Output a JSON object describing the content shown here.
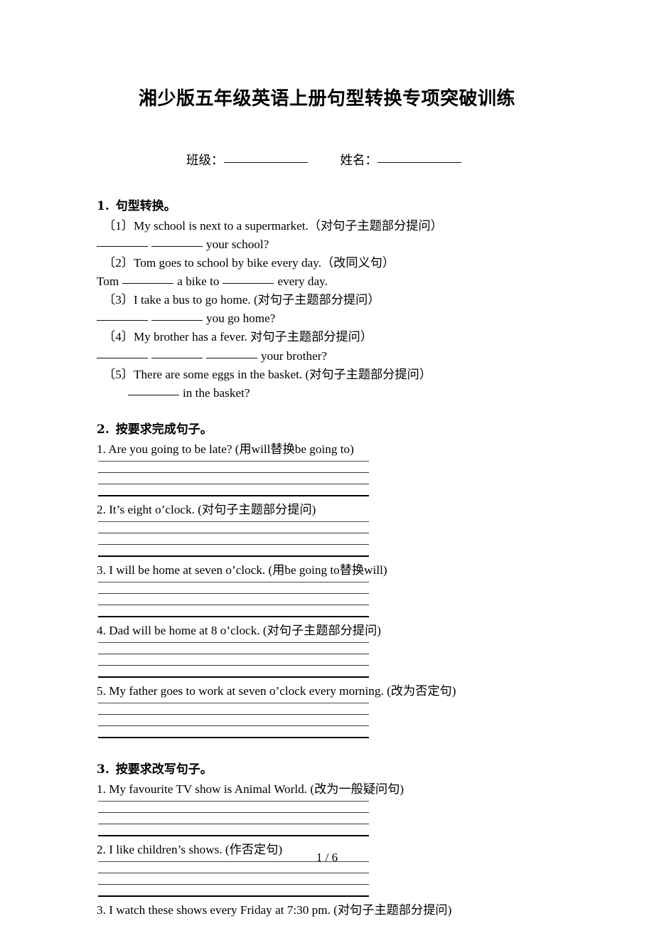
{
  "document": {
    "title": "湘少版五年级英语上册句型转换专项突破训练",
    "footer_page": "1 / 6"
  },
  "id_row": {
    "class_label": "班级：",
    "name_label": "姓名："
  },
  "sections": [
    {
      "number": "1.",
      "heading": "句型转换。",
      "items": [
        {
          "prompt": "〔1〕My school is next to a supermarket.（对句子主题部分提问）",
          "answer": "your school?"
        },
        {
          "prompt": "〔2〕Tom goes to school by bike every day.（改同义句）",
          "answer": "Tom a bike to every day."
        },
        {
          "prompt": "〔3〕I take a bus to go home. (对句子主题部分提问）",
          "answer": "you go home?"
        },
        {
          "prompt": "〔4〕My brother has a fever. 对句子主题部分提问）",
          "answer": "your brother?"
        },
        {
          "prompt": "〔5〕There are some eggs in the basket. (对句子主题部分提问）",
          "answer": "in the basket?"
        }
      ]
    },
    {
      "number": "2.",
      "heading": "按要求完成句子。",
      "items": [
        {
          "prompt": "1. Are you going to be late? (用will替换be going to)"
        },
        {
          "prompt": "2. It's eight o'clock. (对句子主题部分提问)"
        },
        {
          "prompt": "3. I will be home at seven o'clock. (用be going to替换will)"
        },
        {
          "prompt": "4. Dad will be home at 8 o'clock. (对句子主题部分提问)"
        },
        {
          "prompt": "5. My father goes to work at seven o'clock every morning. (改为否定句)"
        }
      ]
    },
    {
      "number": "3.",
      "heading": "按要求改写句子。",
      "items": [
        {
          "prompt": "1. My favourite TV show is Animal World. (改为一般疑问句)"
        },
        {
          "prompt": "2. I like children's shows. (作否定句)"
        },
        {
          "prompt": "3. I watch these shows every Friday at 7:30 pm. (对句子主题部分提问)"
        }
      ]
    }
  ],
  "s1": {
    "p1": "〔1〕My school is next to a supermarket.（对句子主题部分提问）",
    "p2": "〔2〕Tom goes to school by bike every day.（改同义句）",
    "p3": "〔3〕I take a bus to go home. (对句子主题部分提问）",
    "p4": "〔4〕My brother has a fever. 对句子主题部分提问）",
    "p5": "〔5〕There are some eggs in the basket. (对句子主题部分提问）",
    "a1_tail": "your school?",
    "a2_head": "Tom",
    "a2_mid": "a bike to",
    "a2_tail": "every day.",
    "a3_tail": "you go home?",
    "a4_tail": "your brother?",
    "a5_tail": "in the basket?"
  },
  "s2": {
    "q1": "1. Are you going to be late? (用will替换be going to)",
    "q2": "2. It’s eight o’clock. (对句子主题部分提问)",
    "q3": "3. I will be home at seven o’clock. (用be going to替换will)",
    "q4": "4. Dad will be home at 8 o’clock. (对句子主题部分提问)",
    "q5": "5. My father goes to work at seven o’clock every morning. (改为否定句)"
  },
  "s3": {
    "q1": "1. My favourite TV show is Animal World. (改为一般疑问句)",
    "q2": "2. I like children’s shows. (作否定句)",
    "q3": "3. I watch these shows every Friday at 7:30 pm. (对句子主题部分提问)"
  },
  "headings": {
    "h1_num": "1.",
    "h1_text": "句型转换。",
    "h2_num": "2.",
    "h2_text": "按要求完成句子。",
    "h3_num": "3.",
    "h3_text": "按要求改写句子。"
  }
}
